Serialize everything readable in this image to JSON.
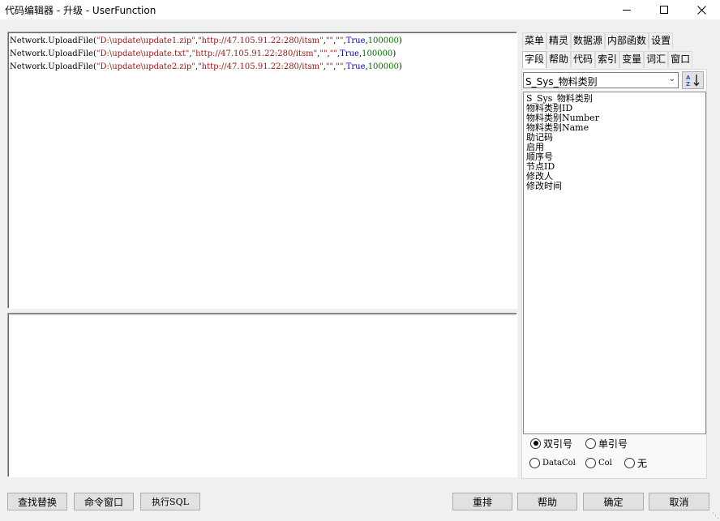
{
  "window": {
    "title": "代码编辑器 - 升级 - UserFunction"
  },
  "editor": {
    "lines": [
      {
        "prefix": "Network.UploadFile(",
        "path": "\"D:\\update\\update1.zip\"",
        "url": "\"http://47.105.91.22:280/itsm\"",
        "e1": "\"\"",
        "e2": "\"\"",
        "bool": "True",
        "num": "100000"
      },
      {
        "prefix": "Network.UploadFile(",
        "path": "\"D:\\update\\update.txt\"",
        "url": "\"http://47.105.91.22:280/itsm\"",
        "e1": "\"\"",
        "e2": "\"\"",
        "bool": "True",
        "num": "100000"
      },
      {
        "prefix": "Network.UploadFile(",
        "path": "\"D:\\update\\update2.zip\"",
        "url": "\"http://47.105.91.22:280/itsm\"",
        "e1": "\"\"",
        "e2": "\"\"",
        "bool": "True",
        "num": "100000"
      }
    ]
  },
  "tabs": {
    "row1": [
      "菜单",
      "精灵",
      "数据源",
      "内部函数",
      "设置"
    ],
    "row2": [
      "字段",
      "帮助",
      "代码",
      "索引",
      "变量",
      "词汇",
      "窗口"
    ],
    "active": "字段"
  },
  "fields": {
    "table_select": "S_Sys_物料类别",
    "items": [
      "S_Sys_物料类别",
      "物料类别ID",
      "物料类别Number",
      "物料类别Name",
      "助记码",
      "启用",
      "顺序号",
      "节点ID",
      "修改人",
      "修改时间"
    ]
  },
  "quotes": {
    "double": "双引号",
    "single": "单引号",
    "datacol": "DataCol",
    "col": "Col",
    "none": "无"
  },
  "buttons": {
    "find_replace": "查找替换",
    "command_window": "命令窗口",
    "exec_sql": "执行SQL",
    "rearrange": "重排",
    "help": "帮助",
    "ok": "确定",
    "cancel": "取消"
  }
}
